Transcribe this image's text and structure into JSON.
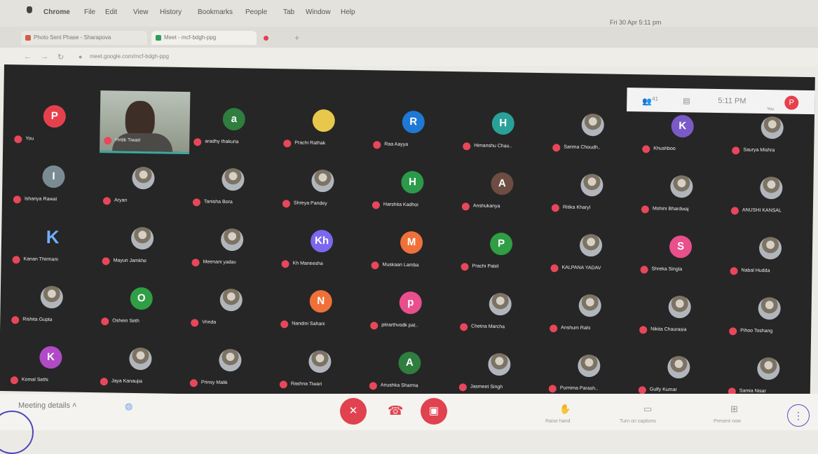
{
  "menubar": {
    "app": "Chrome",
    "items": [
      "File",
      "Edit",
      "View",
      "History",
      "Bookmarks",
      "People",
      "Tab",
      "Window",
      "Help"
    ],
    "clock": "Fri 30 Apr 5:11 pm"
  },
  "tabs": [
    "Photo Sent Phase - Sharapova",
    "Meet - mcf-bdgh-ppg"
  ],
  "address": "meet.google.com/mcf-bdgh-ppg",
  "topright": {
    "participants_count": "41",
    "time": "5:11 PM",
    "you_label": "You"
  },
  "colors": {
    "mic_off": "#e8475a",
    "end_call": "#e0424f",
    "dark_bg": "#262626"
  },
  "tiles": [
    {
      "name": "You",
      "initial": "P",
      "color": "#e6404d"
    },
    {
      "name": "Hritik Tiwari",
      "initial": "",
      "color": ""
    },
    {
      "name": "aradhy thakuria",
      "initial": "a",
      "color": "#2f7d3f"
    },
    {
      "name": "Prachi Rathak",
      "initial": "",
      "color": "#e8c84a"
    },
    {
      "name": "Raa Aayya",
      "initial": "R",
      "color": "#1e78d4"
    },
    {
      "name": "Himanshu Chau..",
      "initial": "H",
      "color": "#2aa198"
    },
    {
      "name": "Sarima Choudh..",
      "initial": "",
      "color": "photo"
    },
    {
      "name": "Khushboo",
      "initial": "K",
      "color": "#7a5ac6"
    },
    {
      "name": "Saurya Mishra",
      "initial": "",
      "color": "photo"
    },
    {
      "name": "Ishanya Rawat",
      "initial": "I",
      "color": "#7a8b94"
    },
    {
      "name": "Aryan",
      "initial": "",
      "color": "photo"
    },
    {
      "name": "Tanisha Bora",
      "initial": "",
      "color": "photo"
    },
    {
      "name": "Shreya Pandey",
      "initial": "",
      "color": "photo"
    },
    {
      "name": "Harshita Kadhoi",
      "initial": "H",
      "color": "#2b9a4b"
    },
    {
      "name": "Anshukanya",
      "initial": "A",
      "color": "#6d4c41"
    },
    {
      "name": "Ritika Kharyl",
      "initial": "",
      "color": "photo"
    },
    {
      "name": "Mohini Bhardwaj",
      "initial": "",
      "color": "photo"
    },
    {
      "name": "ANUSHI KANSAL",
      "initial": "",
      "color": "photo"
    },
    {
      "name": "Kanan Thirmani",
      "initial": "K",
      "color": "none"
    },
    {
      "name": "Mayuri Jamkhe",
      "initial": "",
      "color": "photo"
    },
    {
      "name": "Meenani yadav",
      "initial": "",
      "color": "photo"
    },
    {
      "name": "Kh Maneesha",
      "initial": "Kh",
      "color": "#7b68ee"
    },
    {
      "name": "Muskaan Lamba",
      "initial": "M",
      "color": "#f0703a"
    },
    {
      "name": "Prachi Patel",
      "initial": "P",
      "color": "#2f9e44"
    },
    {
      "name": "KALPANA YADAV",
      "initial": "",
      "color": "photo"
    },
    {
      "name": "Shreka Singla",
      "initial": "S",
      "color": "#e84f8c"
    },
    {
      "name": "Nabal Hudda",
      "initial": "",
      "color": "photo"
    },
    {
      "name": "Rishita Gupta",
      "initial": "",
      "color": "photo"
    },
    {
      "name": "Oshein Seth",
      "initial": "O",
      "color": "#2f9e44"
    },
    {
      "name": "Vrinda",
      "initial": "",
      "color": "photo"
    },
    {
      "name": "Nandini Sahani",
      "initial": "N",
      "color": "#f0703a"
    },
    {
      "name": "pitrarthvodk pat..",
      "initial": "p",
      "color": "#e84f8c"
    },
    {
      "name": "Chetna Marcha",
      "initial": "",
      "color": "photo"
    },
    {
      "name": "Anshum Rahi",
      "initial": "",
      "color": "photo"
    },
    {
      "name": "Nikita Chaurasia",
      "initial": "",
      "color": "photo"
    },
    {
      "name": "Pihoo Toshang",
      "initial": "",
      "color": "photo"
    },
    {
      "name": "Komal Sethi",
      "initial": "K",
      "color": "#b04ac6"
    },
    {
      "name": "Jaya Kanaujia",
      "initial": "",
      "color": "photo"
    },
    {
      "name": "Prinsy Malik",
      "initial": "",
      "color": "photo"
    },
    {
      "name": "Rashna Tiwari",
      "initial": "",
      "color": "photo"
    },
    {
      "name": "Anushka Sharma",
      "initial": "A",
      "color": "#2f7d3f"
    },
    {
      "name": "Jasmeet Singh",
      "initial": "",
      "color": "photo"
    },
    {
      "name": "Purnima Parash..",
      "initial": "",
      "color": "photo"
    },
    {
      "name": "Gulfy Kumar",
      "initial": "",
      "color": "photo"
    },
    {
      "name": "Samia Nisar",
      "initial": "",
      "color": "photo"
    }
  ],
  "controls": {
    "meeting_details": "Meeting details",
    "raise_hand": "Raise hand",
    "captions": "Turn on captions",
    "present": "Present now"
  }
}
